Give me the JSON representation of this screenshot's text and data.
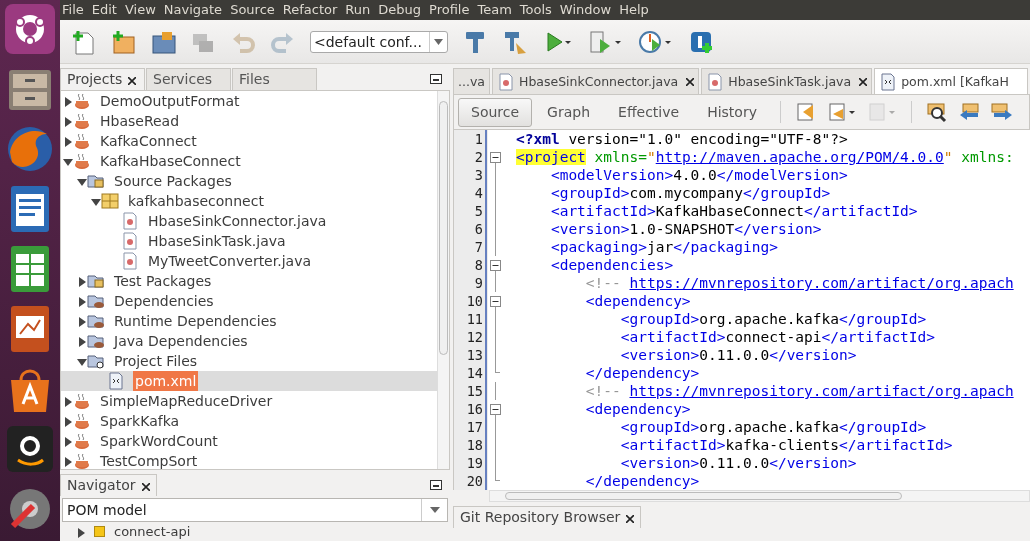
{
  "menu": [
    "File",
    "Edit",
    "View",
    "Navigate",
    "Source",
    "Refactor",
    "Run",
    "Debug",
    "Profile",
    "Team",
    "Tools",
    "Window",
    "Help"
  ],
  "toolbar": {
    "tools": [
      {
        "kind": "new-file",
        "disabled": false
      },
      {
        "kind": "new-project",
        "disabled": false
      },
      {
        "kind": "open-project",
        "disabled": false
      },
      {
        "kind": "close-project",
        "disabled": true
      },
      {
        "kind": "undo",
        "disabled": true
      },
      {
        "kind": "redo",
        "disabled": true
      },
      {
        "kind": "config"
      },
      {
        "kind": "build",
        "disabled": false
      },
      {
        "kind": "clean-build",
        "disabled": false
      },
      {
        "kind": "run",
        "disabled": false
      },
      {
        "kind": "debug",
        "disabled": false
      },
      {
        "kind": "profile",
        "disabled": false
      },
      {
        "kind": "plugin",
        "disabled": false
      }
    ],
    "config": {
      "value": "<default conf..."
    }
  },
  "projects": {
    "tabs": [
      {
        "label": "Projects",
        "selected": true,
        "closable": true
      },
      {
        "label": "Services",
        "selected": false,
        "closable": false
      },
      {
        "label": "Files",
        "selected": false,
        "closable": false
      }
    ],
    "tree": [
      {
        "label": "DemoOutputFormat",
        "kind": "project",
        "expanded": false,
        "selected": false
      },
      {
        "label": "HbaseRead",
        "kind": "project",
        "expanded": false,
        "selected": false
      },
      {
        "label": "KafkaConnect",
        "kind": "project",
        "expanded": false,
        "selected": false
      },
      {
        "label": "KafkaHbaseConnect",
        "kind": "project",
        "expanded": true,
        "selected": false,
        "children": [
          {
            "label": "Source Packages",
            "kind": "source",
            "expanded": true,
            "selected": false,
            "children": [
              {
                "label": "kafkahbaseconnect",
                "kind": "package",
                "expanded": true,
                "selected": false,
                "children": [
                  {
                    "label": "HbaseSinkConnector.java",
                    "kind": "java",
                    "selected": false
                  },
                  {
                    "label": "HbaseSinkTask.java",
                    "kind": "java",
                    "selected": false
                  },
                  {
                    "label": "MyTweetConverter.java",
                    "kind": "java",
                    "selected": false
                  }
                ]
              }
            ]
          },
          {
            "label": "Test Packages",
            "kind": "source",
            "expanded": false,
            "selected": false
          },
          {
            "label": "Dependencies",
            "kind": "library",
            "expanded": false,
            "selected": false
          },
          {
            "label": "Runtime Dependencies",
            "kind": "library",
            "expanded": false,
            "selected": false
          },
          {
            "label": "Java Dependencies",
            "kind": "library",
            "expanded": false,
            "selected": false
          },
          {
            "label": "Project Files",
            "kind": "settings",
            "expanded": true,
            "selected": false,
            "children": [
              {
                "label": "pom.xml",
                "kind": "xml",
                "selected": true
              }
            ]
          }
        ]
      },
      {
        "label": "SimpleMapReduceDriver",
        "kind": "project",
        "expanded": false,
        "selected": false
      },
      {
        "label": "SparkKafka",
        "kind": "project",
        "expanded": false,
        "selected": false
      },
      {
        "label": "SparkWordCount",
        "kind": "project",
        "expanded": false,
        "selected": false
      },
      {
        "label": "TestCompSort",
        "kind": "project",
        "expanded": false,
        "selected": false
      }
    ]
  },
  "navigator": {
    "tab": {
      "label": "Navigator",
      "closable": true
    },
    "combo": {
      "value": "POM model"
    },
    "items": [
      {
        "label": "connect-api",
        "expanded": false
      }
    ]
  },
  "editor_tabs": [
    {
      "label": "...va",
      "kind": "plain",
      "selected": false,
      "closable": false
    },
    {
      "label": "HbaseSinkConnector.java",
      "kind": "java",
      "selected": false,
      "closable": true
    },
    {
      "label": "HbaseSinkTask.java",
      "kind": "java",
      "selected": false,
      "closable": true
    },
    {
      "label": "pom.xml [KafkaH",
      "kind": "xml",
      "selected": true,
      "closable": false
    }
  ],
  "view_tabs": [
    {
      "label": "Source",
      "selected": true
    },
    {
      "label": "Graph",
      "selected": false
    },
    {
      "label": "Effective",
      "selected": false
    },
    {
      "label": "History",
      "selected": false
    }
  ],
  "code_lines": [
    {
      "number": "1",
      "kind": "plain",
      "tokens": [
        {
          "kind": "pi",
          "text": "<?xml"
        },
        {
          "kind": "text",
          "text": " version=\"1.0\" encoding=\"UTF-8\"?>"
        }
      ]
    },
    {
      "number": "2",
      "kind": "fold-start",
      "tokens": [
        {
          "kind": "tag-match",
          "text": "<project"
        },
        {
          "kind": "attr",
          "text": " xmlns="
        },
        {
          "kind": "value",
          "text": "\""
        },
        {
          "kind": "url",
          "text": "http://maven.apache.org/POM/4.0.0"
        },
        {
          "kind": "value",
          "text": "\""
        },
        {
          "kind": "attr",
          "text": " xmlns:"
        }
      ]
    },
    {
      "number": "3",
      "kind": "fold-line",
      "tokens": [
        {
          "kind": "tag",
          "text": "    <modelVersion>"
        },
        {
          "kind": "text",
          "text": "4.0.0"
        },
        {
          "kind": "tag",
          "text": "</modelVersion>"
        }
      ]
    },
    {
      "number": "4",
      "kind": "fold-line",
      "tokens": [
        {
          "kind": "tag",
          "text": "    <groupId>"
        },
        {
          "kind": "text",
          "text": "com.mycompany"
        },
        {
          "kind": "tag",
          "text": "</groupId>"
        }
      ]
    },
    {
      "number": "5",
      "kind": "fold-line",
      "tokens": [
        {
          "kind": "tag",
          "text": "    <artifactId>"
        },
        {
          "kind": "text",
          "text": "KafkaHbaseConnect"
        },
        {
          "kind": "tag",
          "text": "</artifactId>"
        }
      ]
    },
    {
      "number": "6",
      "kind": "fold-line",
      "tokens": [
        {
          "kind": "tag",
          "text": "    <version>"
        },
        {
          "kind": "text",
          "text": "1.0-SNAPSHOT"
        },
        {
          "kind": "tag",
          "text": "</version>"
        }
      ]
    },
    {
      "number": "7",
      "kind": "fold-line",
      "tokens": [
        {
          "kind": "tag",
          "text": "    <packaging>"
        },
        {
          "kind": "text",
          "text": "jar"
        },
        {
          "kind": "tag",
          "text": "</packaging>"
        }
      ]
    },
    {
      "number": "8",
      "kind": "fold-start",
      "tokens": [
        {
          "kind": "tag",
          "text": "    <dependencies>"
        }
      ]
    },
    {
      "number": "9",
      "kind": "fold-line",
      "tokens": [
        {
          "kind": "comment",
          "text": "        <!-- "
        },
        {
          "kind": "url",
          "text": "https://mvnrepository.com/artifact/org.apach"
        }
      ]
    },
    {
      "number": "10",
      "kind": "fold-start",
      "tokens": [
        {
          "kind": "tag",
          "text": "        <dependency>"
        }
      ]
    },
    {
      "number": "11",
      "kind": "fold-line",
      "tokens": [
        {
          "kind": "tag",
          "text": "            <groupId>"
        },
        {
          "kind": "text",
          "text": "org.apache.kafka"
        },
        {
          "kind": "tag",
          "text": "</groupId>"
        }
      ]
    },
    {
      "number": "12",
      "kind": "fold-line",
      "tokens": [
        {
          "kind": "tag",
          "text": "            <artifactId>"
        },
        {
          "kind": "text",
          "text": "connect-api"
        },
        {
          "kind": "tag",
          "text": "</artifactId>"
        }
      ]
    },
    {
      "number": "13",
      "kind": "fold-line",
      "tokens": [
        {
          "kind": "tag",
          "text": "            <version>"
        },
        {
          "kind": "text",
          "text": "0.11.0.0"
        },
        {
          "kind": "tag",
          "text": "</version>"
        }
      ]
    },
    {
      "number": "14",
      "kind": "fold-end",
      "tokens": [
        {
          "kind": "tag",
          "text": "        </dependency>"
        }
      ]
    },
    {
      "number": "15",
      "kind": "fold-line",
      "tokens": [
        {
          "kind": "comment",
          "text": "        <!-- "
        },
        {
          "kind": "url",
          "text": "https://mvnrepository.com/artifact/org.apach"
        }
      ]
    },
    {
      "number": "16",
      "kind": "fold-start",
      "tokens": [
        {
          "kind": "tag",
          "text": "        <dependency>"
        }
      ]
    },
    {
      "number": "17",
      "kind": "fold-line",
      "tokens": [
        {
          "kind": "tag",
          "text": "            <groupId>"
        },
        {
          "kind": "text",
          "text": "org.apache.kafka"
        },
        {
          "kind": "tag",
          "text": "</groupId>"
        }
      ]
    },
    {
      "number": "18",
      "kind": "fold-line",
      "tokens": [
        {
          "kind": "tag",
          "text": "            <artifactId>"
        },
        {
          "kind": "text",
          "text": "kafka-clients"
        },
        {
          "kind": "tag",
          "text": "</artifactId>"
        }
      ]
    },
    {
      "number": "19",
      "kind": "fold-line",
      "tokens": [
        {
          "kind": "tag",
          "text": "            <version>"
        },
        {
          "kind": "text",
          "text": "0.11.0.0"
        },
        {
          "kind": "tag",
          "text": "</version>"
        }
      ]
    },
    {
      "number": "20",
      "kind": "fold-end",
      "tokens": [
        {
          "kind": "tag",
          "text": "        </dependency>"
        }
      ]
    }
  ],
  "bottom_tab": {
    "label": "Git Repository Browser",
    "closable": true
  }
}
